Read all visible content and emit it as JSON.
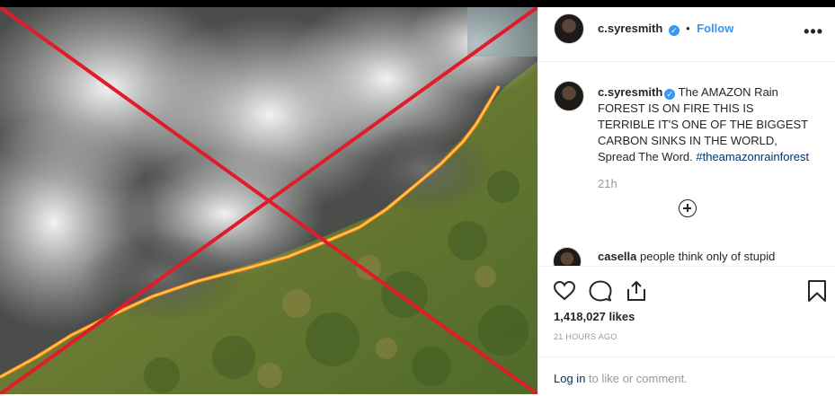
{
  "post": {
    "username": "c.syresmith",
    "verified_mark": "✓",
    "follow_label": "Follow",
    "separator": "•",
    "more_label": "•••"
  },
  "caption": {
    "username": "c.syresmith",
    "text": "The AMAZON Rain FOREST IS ON FIRE THIS IS TERRIBLE IT'S ONE OF THE BIGGEST CARBON SINKS IN THE WORLD, Spread The Word.",
    "hashtag": "#theamazonrainforest",
    "age": "21h"
  },
  "comment": {
    "username": "casella",
    "text": "people think only of stupid"
  },
  "actions": {
    "icons": [
      "heart-icon",
      "comment-icon",
      "share-icon",
      "bookmark-icon"
    ]
  },
  "stats": {
    "likes": "1,418,027 likes",
    "posted": "21 HOURS AGO"
  },
  "login": {
    "link": "Log in",
    "suffix": " to like or comment."
  },
  "colors": {
    "accent": "#3897f0",
    "cross": "#e21b2a",
    "link": "#003569"
  }
}
